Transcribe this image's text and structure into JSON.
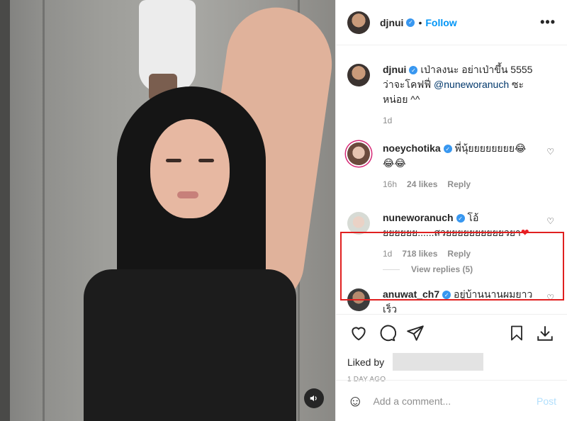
{
  "post": {
    "author": "djnui",
    "follow_label": "Follow",
    "separator": "•",
    "more_label": "•••"
  },
  "caption": {
    "user": "djnui",
    "text_pre": "เป่าลงนะ อย่าเป่าขึ้น 5555 ว่าจะโคฟฟี่ ",
    "mention": "@nuneworanuch",
    "text_post": " ซะหน่อย ^^",
    "time": "1d"
  },
  "comments": [
    {
      "user": "noeychotika",
      "text": "พี่นุ้ยยยยยยยย😂😂😂",
      "time": "16h",
      "likes": "24 likes",
      "reply_label": "Reply"
    },
    {
      "user": "nuneworanuch",
      "text": "โอ้ยยยยยย......สวยยยยยยยยยยวยา",
      "emoji": "❤",
      "time": "1d",
      "likes": "718 likes",
      "reply_label": "Reply",
      "view_replies": "View replies (5)"
    },
    {
      "user": "anuwat_ch7",
      "text": "อยู่บ้านนานผมยาวเร็ว"
    }
  ],
  "actions": {
    "liked_by_label": "Liked by",
    "time_ago": "1 DAY AGO"
  },
  "add_comment": {
    "placeholder": "Add a comment...",
    "post_label": "Post"
  },
  "icons": [
    "heart-icon",
    "comment-icon",
    "share-icon",
    "bookmark-icon",
    "download-icon",
    "volume-icon",
    "smile-icon",
    "more-icon",
    "verified-icon"
  ],
  "colors": {
    "follow": "#0095f6",
    "verified": "#3897f0",
    "highlight": "#e02020",
    "post_disabled": "#b2dffc"
  }
}
